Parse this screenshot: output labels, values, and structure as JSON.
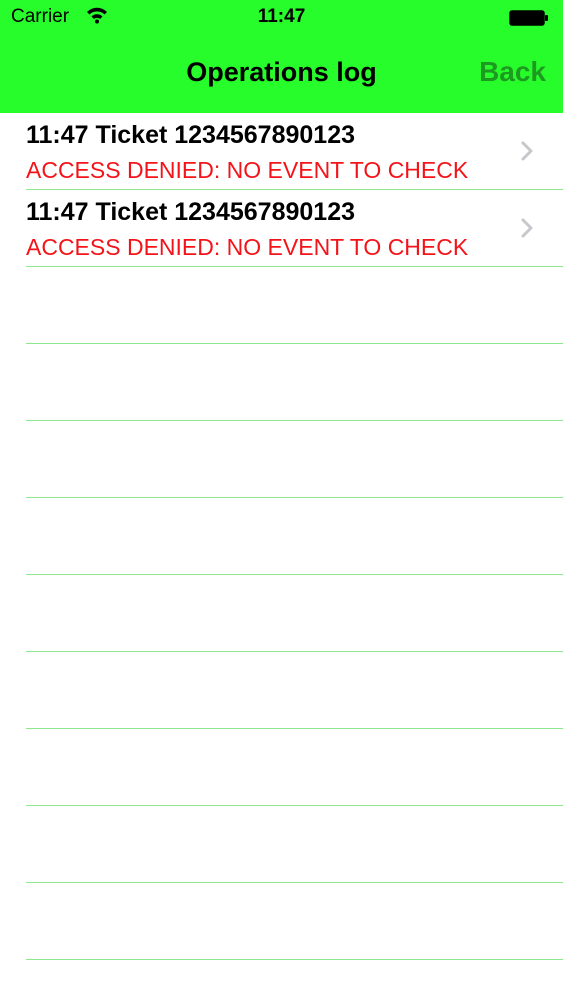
{
  "status_bar": {
    "carrier": "Carrier",
    "time": "11:47",
    "wifi_icon": "wifi-icon",
    "battery_icon": "battery-icon"
  },
  "nav": {
    "title": "Operations log",
    "back_label": "Back"
  },
  "colors": {
    "bar": "#26fd2a",
    "back": "#1d9b20",
    "error": "#f3141a",
    "separator": "#8fe88f"
  },
  "log": {
    "entries": [
      {
        "title": "11:47 Ticket 1234567890123",
        "status": "ACCESS DENIED: NO EVENT TO CHECK"
      },
      {
        "title": "11:47 Ticket 1234567890123",
        "status": "ACCESS DENIED: NO EVENT TO CHECK"
      }
    ]
  }
}
